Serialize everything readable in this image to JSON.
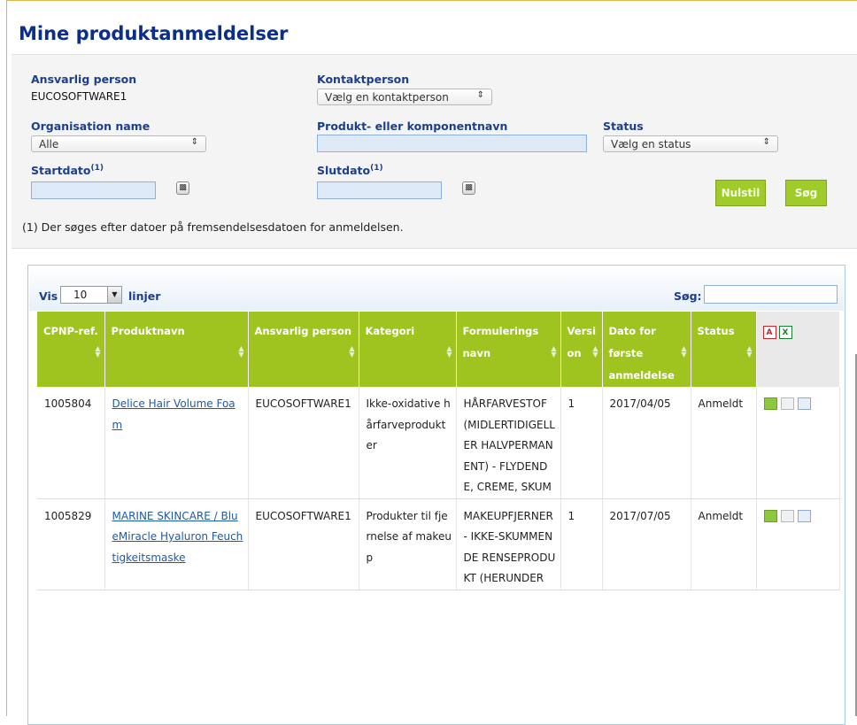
{
  "page": {
    "title": "Mine produktanmeldelser"
  },
  "filters": {
    "responsible_label": "Ansvarlig person",
    "responsible_value": "EUCOSOFTWARE1",
    "contact_label": "Kontaktperson",
    "contact_value": "Vælg en kontaktperson",
    "org_label": "Organisation name",
    "org_value": "Alle",
    "product_label": "Produkt- eller komponentnavn",
    "product_value": "",
    "status_label": "Status",
    "status_value": "Vælg en status",
    "start_label": "Startdato",
    "end_label": "Slutdato",
    "footnote_mark": "(1)",
    "reset_button": "Nulstil",
    "search_button": "Søg",
    "note": "(1) Der søges efter datoer på fremsendelsesdatoen for anmeldelsen."
  },
  "table_controls": {
    "vis_label": "Vis",
    "page_size": "10",
    "lines_label": "linjer",
    "search_label": "Søg:",
    "search_value": ""
  },
  "columns": [
    "CPNP-ref.",
    "Produktnavn",
    "Ansvarlig person",
    "Kategori",
    "Formulerings navn",
    "Versi on",
    "Dato for første anmeldelse",
    "Status"
  ],
  "export_icons": [
    "pdf-icon",
    "excel-icon"
  ],
  "rows": [
    {
      "ref": "1005804",
      "product": "Delice Hair Volume Foam",
      "person": "EUCOSOFTWARE1",
      "category": "Ikke-oxidative hårfarveprodukter",
      "formulation": "HÅRFARVESTOF (MIDLERTIDIGELLER HALVPERMANENT) - FLYDENDE, CREME, SKUM",
      "version": "1",
      "date": "2017/04/05",
      "status": "Anmeldt"
    },
    {
      "ref": "1005829",
      "product": "MARINE SKINCARE / BlueMiracle Hyaluron Feuchtigkeitsmaske",
      "person": "EUCOSOFTWARE1",
      "category": "Produkter til fjernelse af makeup",
      "formulation": "MAKEUPFJERNER - IKKE-SKUMMENDE RENSEPRODUKT (HERUNDER",
      "version": "1",
      "date": "2017/07/05",
      "status": "Anmeldt"
    }
  ],
  "colors": {
    "title": "#0b2e8a",
    "label": "#1b3e8f",
    "header_green": "#9fc41f",
    "button_green": "#9fcb2b",
    "link": "#1e5aa8"
  }
}
